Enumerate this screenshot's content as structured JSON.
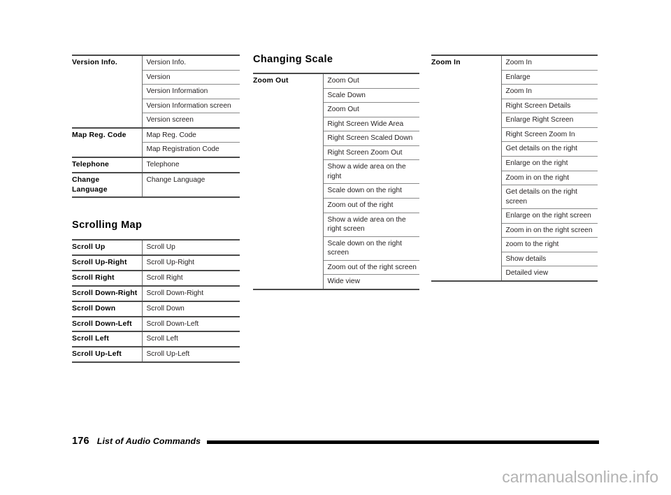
{
  "page": {
    "number": "176",
    "footer_title": "List of Audio Commands",
    "watermark": "carmanualsonline.info"
  },
  "columns": {
    "left": {
      "table_top": {
        "groups": [
          {
            "command": "Version Info.",
            "phrases": [
              "Version Info.",
              "Version",
              "Version Information",
              "Version Information screen",
              "Version screen"
            ]
          },
          {
            "command": "Map Reg. Code",
            "phrases": [
              "Map Reg. Code",
              "Map Registration Code"
            ]
          },
          {
            "command": "Telephone",
            "phrases": [
              "Telephone"
            ]
          },
          {
            "command": "Change Language",
            "command_line1": "Change",
            "command_line2": "Language",
            "phrases": [
              "Change Language"
            ]
          }
        ]
      },
      "heading": "Scrolling Map",
      "table_bottom": {
        "groups": [
          {
            "command": "Scroll Up",
            "phrases": [
              "Scroll Up"
            ]
          },
          {
            "command": "Scroll Up-Right",
            "phrases": [
              "Scroll Up-Right"
            ]
          },
          {
            "command": "Scroll Right",
            "phrases": [
              "Scroll Right"
            ]
          },
          {
            "command": "Scroll Down-Right",
            "phrases": [
              "Scroll Down-Right"
            ]
          },
          {
            "command": "Scroll Down",
            "phrases": [
              "Scroll Down"
            ]
          },
          {
            "command": "Scroll Down-Left",
            "phrases": [
              "Scroll Down-Left"
            ]
          },
          {
            "command": "Scroll Left",
            "phrases": [
              "Scroll Left"
            ]
          },
          {
            "command": "Scroll Up-Left",
            "phrases": [
              "Scroll Up-Left"
            ]
          }
        ]
      }
    },
    "middle": {
      "heading": "Changing Scale",
      "table": {
        "groups": [
          {
            "command": "Zoom Out",
            "phrases": [
              "Zoom Out",
              "Scale Down",
              "Zoom Out",
              "Right Screen Wide Area",
              "Right Screen Scaled Down",
              "Right Screen Zoom Out",
              "Show a wide area on the right",
              "Scale down on the right",
              "Zoom out of the right",
              "Show a wide area on the right screen",
              "Scale down on the right screen",
              "Zoom out of the right screen",
              "Wide view"
            ]
          }
        ]
      }
    },
    "right": {
      "table": {
        "groups": [
          {
            "command": "Zoom In",
            "phrases": [
              "Zoom In",
              "Enlarge",
              "Zoom In",
              "Right Screen Details",
              "Enlarge Right Screen",
              "Right Screen Zoom In",
              "Get details on the right",
              "Enlarge on the right",
              "Zoom in on the right",
              "Get details on the right screen",
              "Enlarge on the right screen",
              "Zoom in on the right screen",
              "zoom to the right",
              "Show details",
              "Detailed view"
            ]
          }
        ]
      }
    }
  }
}
